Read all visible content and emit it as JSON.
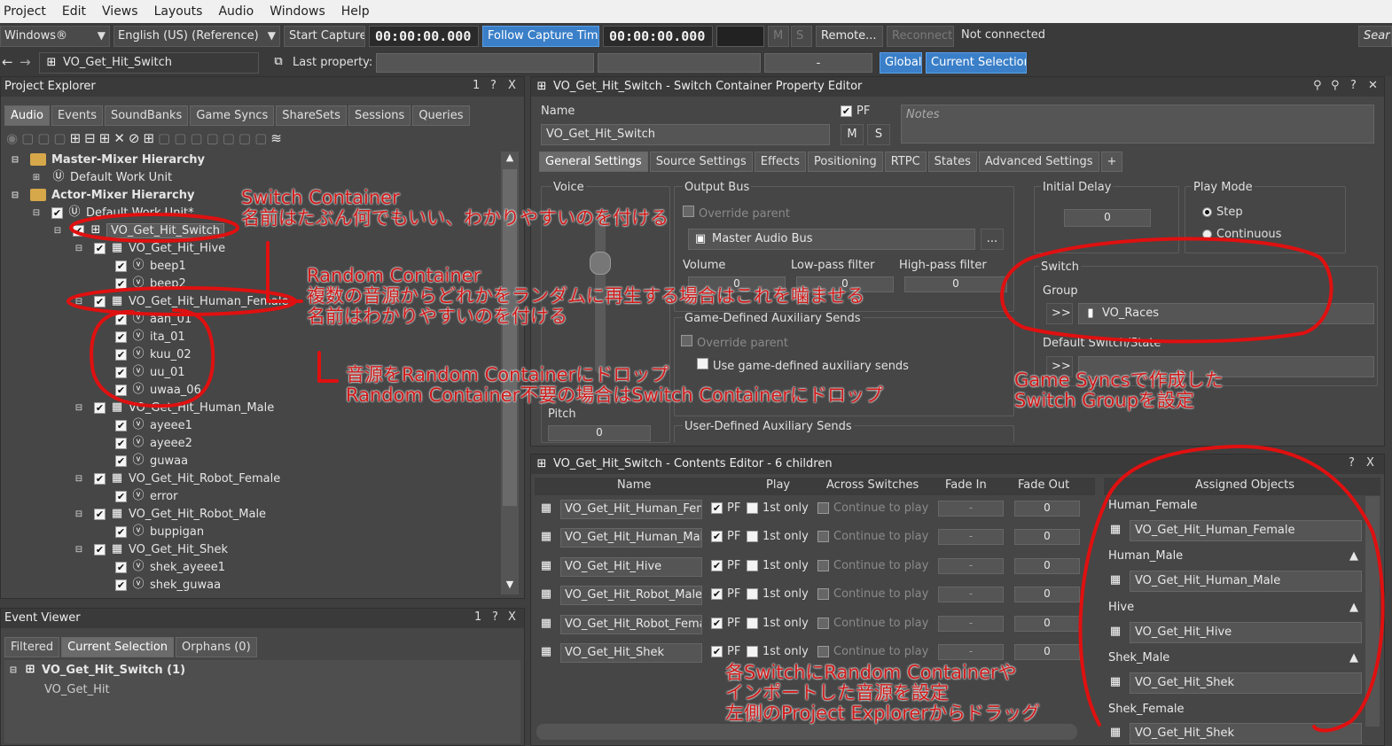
{
  "menubar": {
    "items": [
      "Project",
      "Edit",
      "Views",
      "Layouts",
      "Audio",
      "Windows",
      "Help"
    ]
  },
  "toolbar": {
    "platform": "Windows®",
    "language": "English (US) (Reference)",
    "start_capture": "Start Capture",
    "time1": "00:00:00.000",
    "follow_capture": "Follow Capture Time",
    "time2": "00:00:00.000",
    "m": "M",
    "s": "S",
    "remote": "Remote...",
    "reconnect": "Reconnect",
    "status": "Not connected",
    "search": "Sear"
  },
  "toolbar2": {
    "object_name": "VO_Get_Hit_Switch",
    "last_property": "Last property:",
    "dash": "-",
    "global": "Global",
    "current_selection": "Current Selection"
  },
  "project_explorer": {
    "title": "Project Explorer",
    "controls": [
      "1",
      "?",
      "X"
    ],
    "tabs": [
      "Audio",
      "Events",
      "SoundBanks",
      "Game Syncs",
      "ShareSets",
      "Sessions",
      "Queries"
    ],
    "tree": [
      "Master-Mixer Hierarchy",
      "Default Work Unit",
      "Actor-Mixer Hierarchy",
      "Default Work Unit*",
      "VO_Get_Hit_Switch",
      "VO_Get_Hit_Hive",
      "beep1",
      "beep2",
      "VO_Get_Hit_Human_Female",
      "aah_01",
      "ita_01",
      "kuu_02",
      "uu_01",
      "uwaa_06",
      "VO_Get_Hit_Human_Male",
      "ayeee1",
      "ayeee2",
      "guwaa",
      "VO_Get_Hit_Robot_Female",
      "error",
      "VO_Get_Hit_Robot_Male",
      "buppigan",
      "VO_Get_Hit_Shek",
      "shek_ayeee1",
      "shek_guwaa"
    ]
  },
  "event_viewer": {
    "title": "Event Viewer",
    "controls": [
      "1",
      "?",
      "X"
    ],
    "tabs": [
      "Filtered",
      "Current Selection",
      "Orphans (0)"
    ],
    "items": [
      "VO_Get_Hit_Switch (1)",
      "VO_Get_Hit"
    ]
  },
  "property_editor": {
    "title": "VO_Get_Hit_Switch - Switch Container Property Editor",
    "name_label": "Name",
    "name_value": "VO_Get_Hit_Switch",
    "pf": "PF",
    "m": "M",
    "s": "S",
    "notes_placeholder": "Notes",
    "tabs": [
      "General Settings",
      "Source Settings",
      "Effects",
      "Positioning",
      "RTPC",
      "States",
      "Advanced Settings",
      "+"
    ],
    "voice": "Voice",
    "output_bus": "Output Bus",
    "override_parent": "Override parent",
    "master_bus": "Master Audio Bus",
    "browse": "...",
    "volume": "Volume",
    "lowpass": "Low-pass filter",
    "highpass": "High-pass filter",
    "zero": "0",
    "game_aux": "Game-Defined Auxiliary Sends",
    "override_parent2": "Override parent",
    "use_game_aux": "Use game-defined auxiliary sends",
    "pitch": "Pitch",
    "user_aux": "User-Defined Auxiliary Sends",
    "initial_delay": "Initial Delay",
    "play_mode": "Play Mode",
    "step": "Step",
    "continuous": "Continuous",
    "switch": "Switch",
    "group": "Group",
    "arrow_btn": ">>",
    "group_value": "VO_Races",
    "default_switch": "Default Switch/State"
  },
  "contents_editor": {
    "title": "VO_Get_Hit_Switch - Contents Editor - 6 children",
    "controls": [
      "?",
      "X"
    ],
    "columns": [
      "Name",
      "Play",
      "Across Switches",
      "Fade In",
      "Fade Out"
    ],
    "pf": "PF",
    "first_only": "1st only",
    "continue": "Continue to play",
    "dash": "-",
    "zero": "0",
    "rows": [
      "VO_Get_Hit_Human_Fem",
      "VO_Get_Hit_Human_Male",
      "VO_Get_Hit_Hive",
      "VO_Get_Hit_Robot_Male",
      "VO_Get_Hit_Robot_Female",
      "VO_Get_Hit_Shek"
    ],
    "assigned_header": "Assigned Objects",
    "assigned": [
      {
        "switch": "Human_Female",
        "object": "VO_Get_Hit_Human_Female"
      },
      {
        "switch": "Human_Male",
        "object": "VO_Get_Hit_Human_Male"
      },
      {
        "switch": "Hive",
        "object": "VO_Get_Hit_Hive"
      },
      {
        "switch": "Shek_Male",
        "object": "VO_Get_Hit_Shek"
      },
      {
        "switch": "Shek_Female",
        "object": "VO_Get_Hit_Shek"
      }
    ]
  },
  "annotations": {
    "a1_l1": "Switch Container",
    "a1_l2": "名前はたぶん何でもいい、わかりやすいのを付ける",
    "a2_l1": "Random Container",
    "a2_l2": "複数の音源からどれかをランダムに再生する場合はこれを噛ませる",
    "a2_l3": "名前はわかりやすいのを付ける",
    "a3_l1": "音源をRandom Containerにドロップ",
    "a3_l2": "Random Container不要の場合はSwitch Containerにドロップ",
    "a4_l1": "Game Syncsで作成した",
    "a4_l2": "Switch Groupを設定",
    "a5_l1": "各SwitchにRandom Containerや",
    "a5_l2": "インポートした音源を設定",
    "a5_l3": "左側のProject Explorerからドラッグ"
  },
  "colors": {
    "annotation": "#d01818",
    "accent_blue": "#3a7fc8",
    "folder": "#d6a84a"
  }
}
